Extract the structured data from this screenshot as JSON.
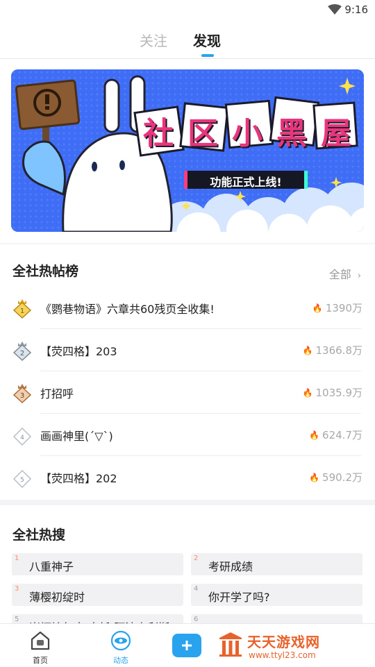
{
  "status": {
    "time": "9:16"
  },
  "tabs": [
    {
      "label": "关注",
      "active": false
    },
    {
      "label": "发现",
      "active": true
    }
  ],
  "banner": {
    "title": "社区小黑屋",
    "subtitle": "功能正式上线!"
  },
  "hot_posts": {
    "title": "全社热帖榜",
    "more_label": "全部",
    "items": [
      {
        "rank": "1",
        "title": "《鹦巷物语》六章共60残页全收集!",
        "heat": "1390万"
      },
      {
        "rank": "2",
        "title": "【荧四格】203",
        "heat": "1366.8万"
      },
      {
        "rank": "3",
        "title": "打招呼",
        "heat": "1035.9万"
      },
      {
        "rank": "4",
        "title": "画画神里(´▽`)",
        "heat": "624.7万"
      },
      {
        "rank": "5",
        "title": "【荧四格】202",
        "heat": "590.2万"
      }
    ]
  },
  "hot_search": {
    "title": "全社热搜",
    "items": [
      {
        "rank": "1",
        "text": "八重神子"
      },
      {
        "rank": "2",
        "text": "考研成绩"
      },
      {
        "rank": "3",
        "text": "薄樱初绽时"
      },
      {
        "rank": "4",
        "text": "你开学了吗?"
      },
      {
        "rank": "5",
        "text": "崩坏铭年中 奥托 阿波卡利斯"
      },
      {
        "rank": "6",
        "text": ""
      }
    ]
  },
  "bottom_nav": {
    "home_label": "首页",
    "feed_label": "动态"
  },
  "watermark": {
    "text": "天天游戏网",
    "url": "www.ttyl23.com"
  },
  "colors": {
    "accent": "#2aa3ef",
    "banner_blue": "#3f6df5",
    "title_pink": "#e8357c"
  }
}
